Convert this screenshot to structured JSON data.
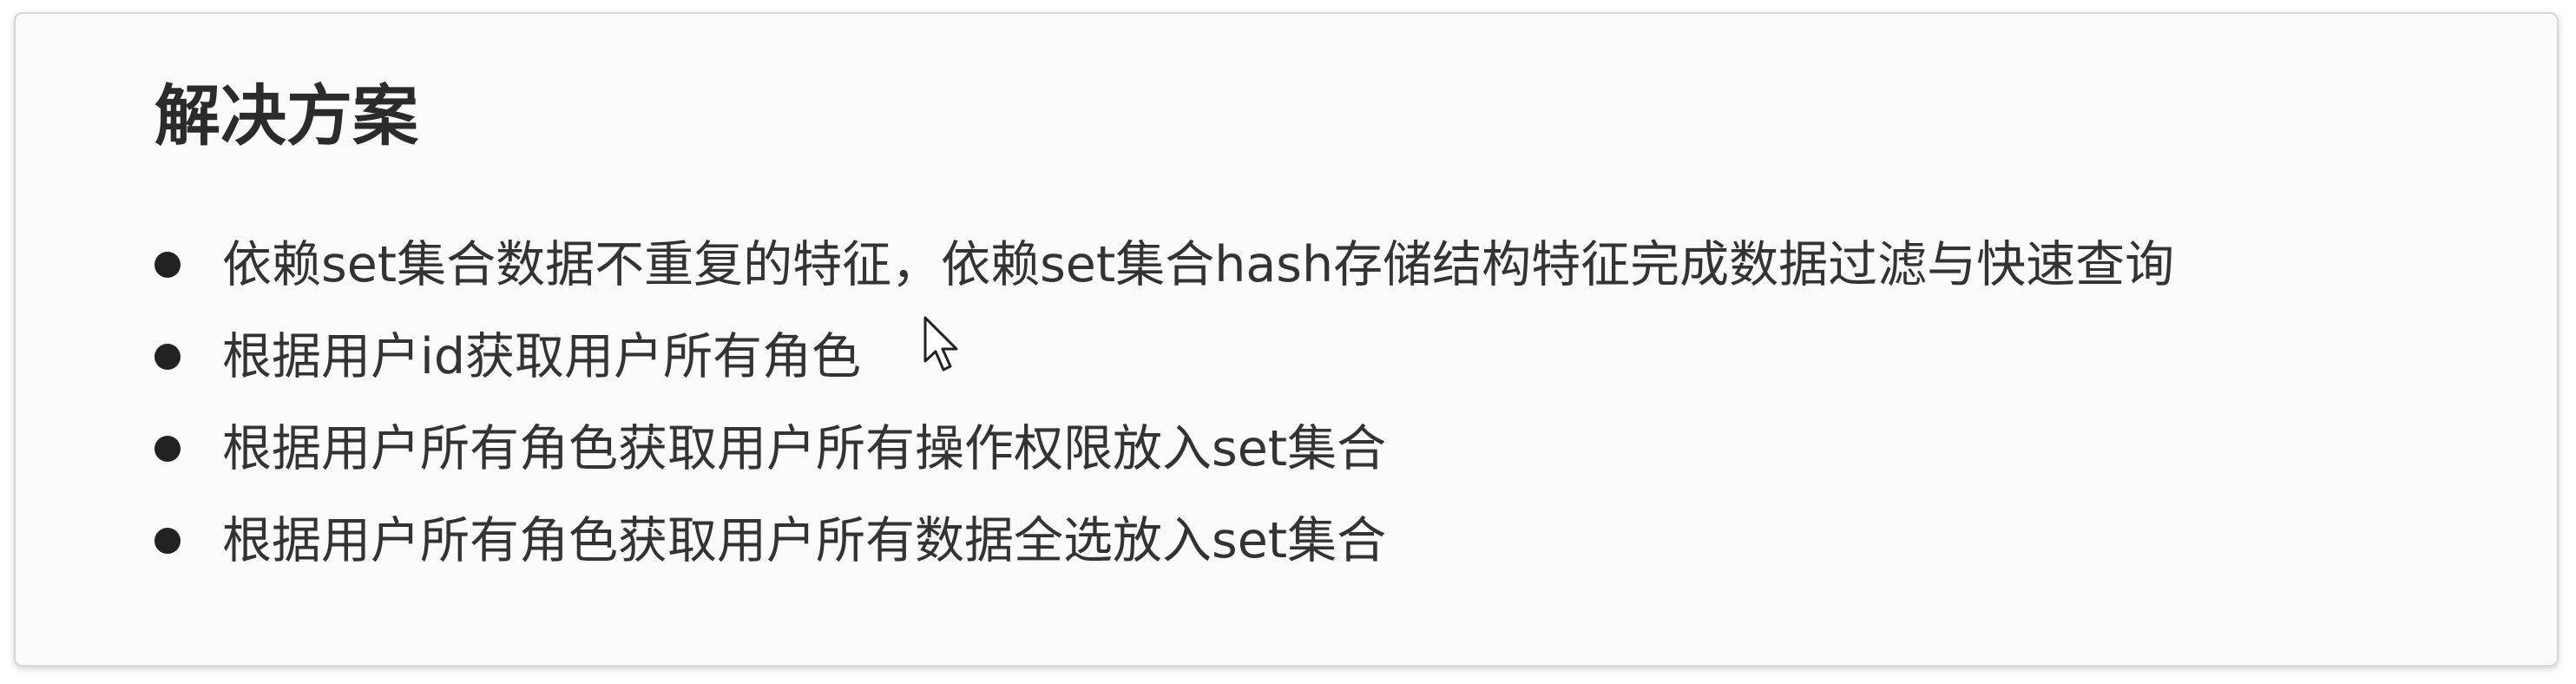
{
  "section": {
    "title": "解决方案"
  },
  "bullets": [
    {
      "text": "依赖set集合数据不重复的特征，依赖set集合hash存储结构特征完成数据过滤与快速查询"
    },
    {
      "text": "根据用户id获取用户所有角色"
    },
    {
      "text": "根据用户所有角色获取用户所有操作权限放入set集合"
    },
    {
      "text": "根据用户所有角色获取用户所有数据全选放入set集合"
    }
  ],
  "icons": {
    "bullet": "filled-circle",
    "cursor": "mouse-pointer-icon"
  },
  "colors": {
    "title": "#2b2b2b",
    "text": "#333333",
    "card_background": "#fbfbfb",
    "card_border": "#d6d6d6"
  }
}
